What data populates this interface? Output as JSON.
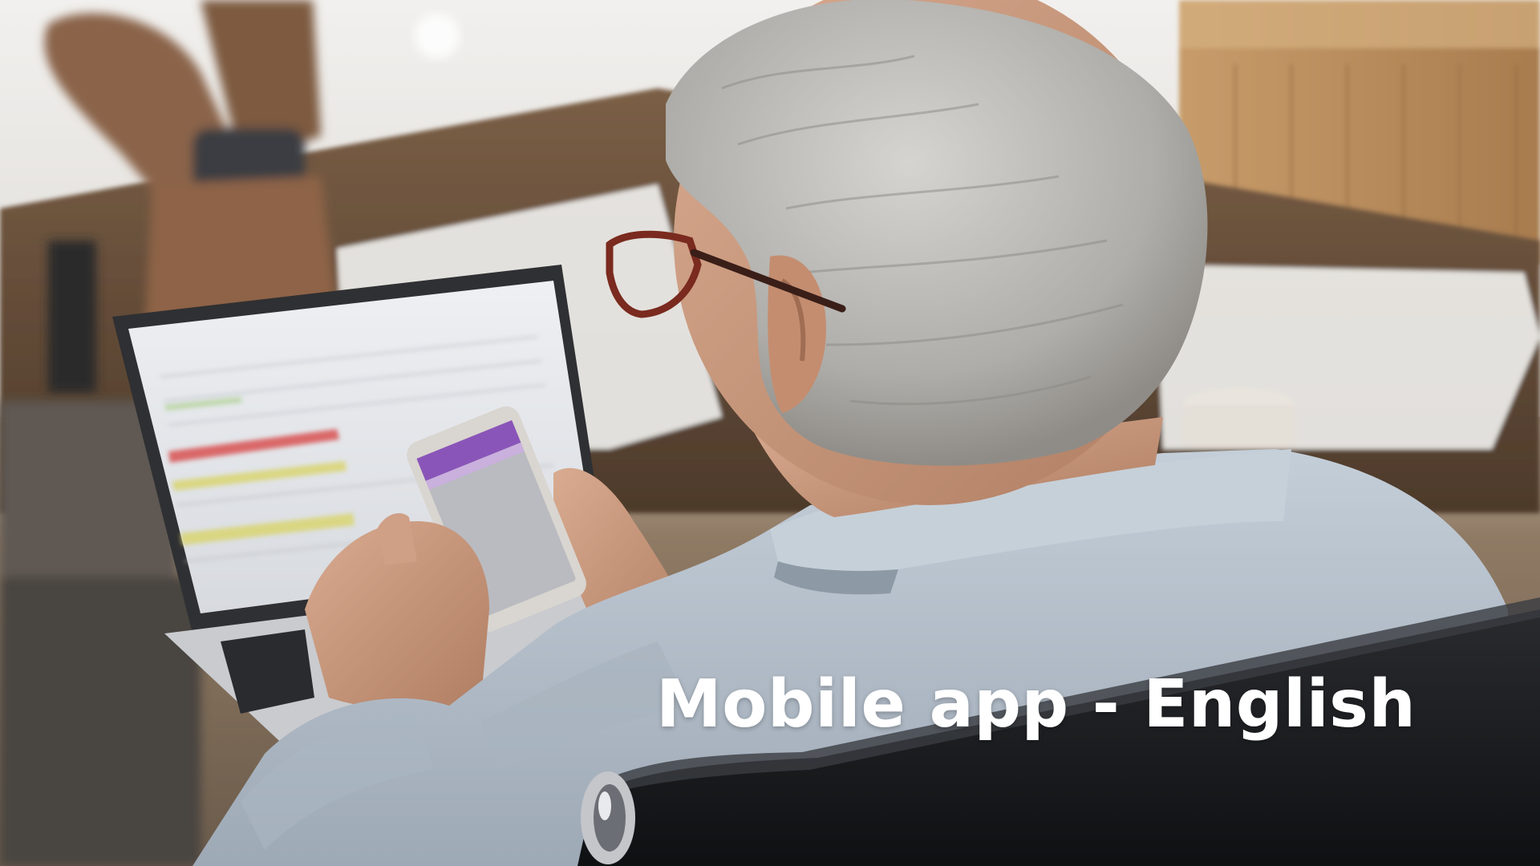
{
  "slide": {
    "caption": "Mobile app - English"
  },
  "photo": {
    "subject": "man-with-grey-hair-using-smartphone-and-laptop",
    "palette": {
      "wall": "#ecebe8",
      "wood": "#b48a5c",
      "desk": "#6e5540",
      "shirt": "#b4c0cc",
      "shirt_shadow": "#8e99a6",
      "hair": "#b9b8b5",
      "skin": "#c89a80",
      "glasses": "#7a2a1e",
      "laptop_body": "#c9cbcf",
      "laptop_screen": "#e4e6ea",
      "phone": "#d8d4cf",
      "phone_screen_accent": "#8a55b8",
      "chair": "#17181b",
      "boot": "#8a6448"
    }
  }
}
